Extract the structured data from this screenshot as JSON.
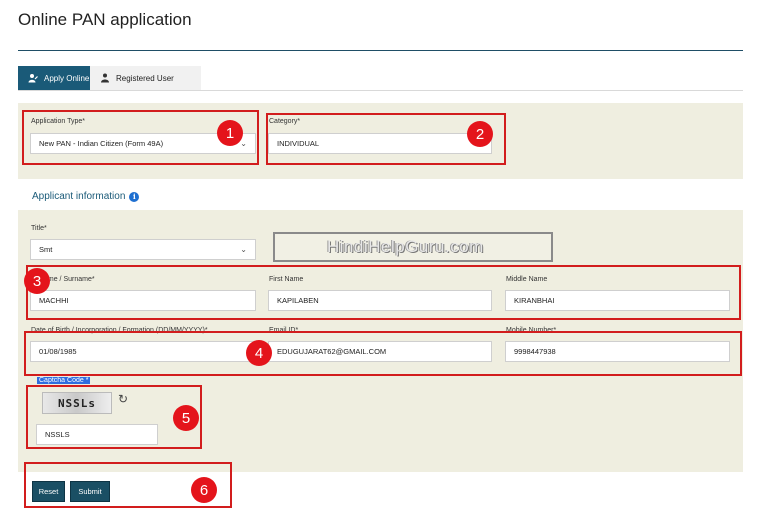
{
  "page": {
    "title": "Online PAN application"
  },
  "tabs": [
    {
      "label": "Apply Online",
      "icon": "user-edit-icon"
    },
    {
      "label": "Registered User",
      "icon": "users-icon"
    }
  ],
  "application": {
    "type_label": "Application Type*",
    "type_value": "New PAN - Indian Citizen (Form 49A)",
    "category_label": "Category*",
    "category_value": "INDIVIDUAL"
  },
  "section": {
    "heading": "Applicant information",
    "info_icon": "i"
  },
  "applicant": {
    "title_label": "Title*",
    "title_value": "Smt",
    "last_name_label": "ame / Surname*",
    "last_name_value": "MACHHI",
    "first_name_label": "First Name",
    "first_name_value": "KAPILABEN",
    "middle_name_label": "Middle Name",
    "middle_name_value": "KIRANBHAI",
    "dob_label": "Date of Birth / Incorporation / Formation (DD/MM/YYYY)*",
    "dob_value": "01/08/1985",
    "email_label": "Email ID*",
    "email_value": "EDUGUJARAT62@GMAIL.COM",
    "mobile_label": "Mobile Number*",
    "mobile_value": "9998447938"
  },
  "captcha": {
    "label": "Captcha Code *",
    "image_text": "NSSLs",
    "input_value": "NSSLS",
    "refresh_glyph": "↻"
  },
  "buttons": {
    "reset": "Reset",
    "submit": "Submit"
  },
  "watermark": "HindiHelpGuru.com",
  "annotations": [
    "1",
    "2",
    "3",
    "4",
    "5",
    "6"
  ],
  "colors": {
    "accent": "#1a5a78",
    "panel": "#efeee0",
    "highlight": "#d21d1d",
    "badge": "#e4141b"
  }
}
